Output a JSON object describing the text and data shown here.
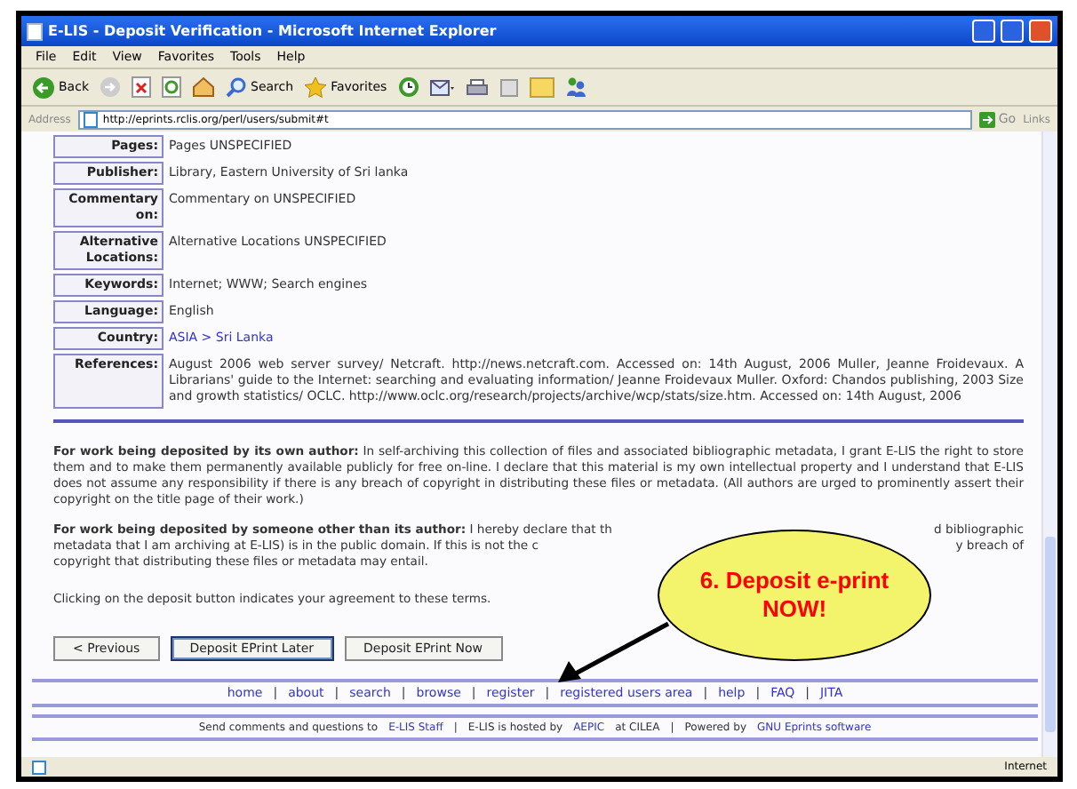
{
  "window": {
    "title": "E-LIS - Deposit Verification - Microsoft Internet Explorer"
  },
  "menu": [
    "File",
    "Edit",
    "View",
    "Favorites",
    "Tools",
    "Help"
  ],
  "toolbar": [
    {
      "kind": "back",
      "label": "Back"
    },
    {
      "kind": "forward"
    },
    {
      "kind": "stop"
    },
    {
      "kind": "refresh"
    },
    {
      "kind": "home"
    },
    {
      "kind": "search",
      "label": "Search"
    },
    {
      "kind": "favorites",
      "label": "Favorites"
    },
    {
      "kind": "history"
    },
    {
      "kind": "mail"
    },
    {
      "kind": "print"
    },
    {
      "kind": "edit"
    },
    {
      "kind": "folder"
    },
    {
      "kind": "messenger"
    }
  ],
  "address": {
    "label": "Address",
    "value": "http://eprints.rclis.org/perl/users/submit#t",
    "go": "Go",
    "links": "Links"
  },
  "fields": [
    {
      "label": "Pages:",
      "value": "Pages UNSPECIFIED"
    },
    {
      "label": "Publisher:",
      "value": "Library, Eastern University of Sri lanka"
    },
    {
      "label": "Commentary on:",
      "value": "Commentary on UNSPECIFIED"
    },
    {
      "label": "Alternative Locations:",
      "value": "Alternative Locations UNSPECIFIED"
    },
    {
      "label": "Keywords:",
      "value": "Internet; WWW; Search engines"
    },
    {
      "label": "Language:",
      "value": "English"
    },
    {
      "label": "Country:",
      "value": "ASIA > Sri Lanka",
      "kind": "link"
    },
    {
      "label": "References:",
      "value": "August 2006 web server survey/ Netcraft. http://news.netcraft.com. Accessed on: 14th August, 2006 Muller, Jeanne Froidevaux. A Librarians' guide to the Internet: searching and evaluating information/ Jeanne Froidevaux Muller. Oxford: Chandos publishing, 2003 Size and growth statistics/ OCLC. http://www.oclc.org/research/projects/archive/wcp/stats/size.htm. Accessed on: 14th August, 2006"
    }
  ],
  "terms_own": "**For work being deposited by its own author:** In self-archiving this collection of files and associated bibliographic metadata, I grant E-LIS the right to store them and to make them permanently available publicly for free on-line. I declare that this material is my own intellectual property and I understand that E-LIS does not assume any responsibility if there is any breach of copyright in distributing these files or metadata. (All authors are urged to prominently assert their copyright on the title page of their work.)",
  "terms_other": [
    {
      "left": "**For work being deposited by someone other than its author:** I hereby declare that th",
      "right": "d bibliographic"
    },
    {
      "left": "metadata that I am archiving at E-LIS) is in the public domain. If this is not the c",
      "right": "y breach of"
    },
    {
      "left": "copyright that distributing these files or metadata may entail."
    }
  ],
  "agreement": "Clicking on the deposit button indicates your agreement to these terms.",
  "buttons": [
    {
      "label": "< Previous",
      "selected": false
    },
    {
      "label": "Deposit EPrint Later",
      "selected": true
    },
    {
      "label": "Deposit EPrint Now",
      "selected": false
    }
  ],
  "nav_separator": "|",
  "footer_separator": "|",
  "nav": [
    "home",
    "about",
    "search",
    "browse",
    "register",
    "registered users area",
    "help",
    "FAQ",
    "JITA"
  ],
  "footer": [
    {
      "text": "Send comments and questions to ",
      "link": "E-LIS Staff"
    },
    {
      "text": "E-LIS is hosted by ",
      "link": "AEPIC",
      "after": " at CILEA"
    },
    {
      "text": "Powered by ",
      "link": "GNU Eprints software"
    }
  ],
  "callout": {
    "text": "6. Deposit e-print NOW!"
  },
  "status": {
    "zone": "Internet"
  }
}
